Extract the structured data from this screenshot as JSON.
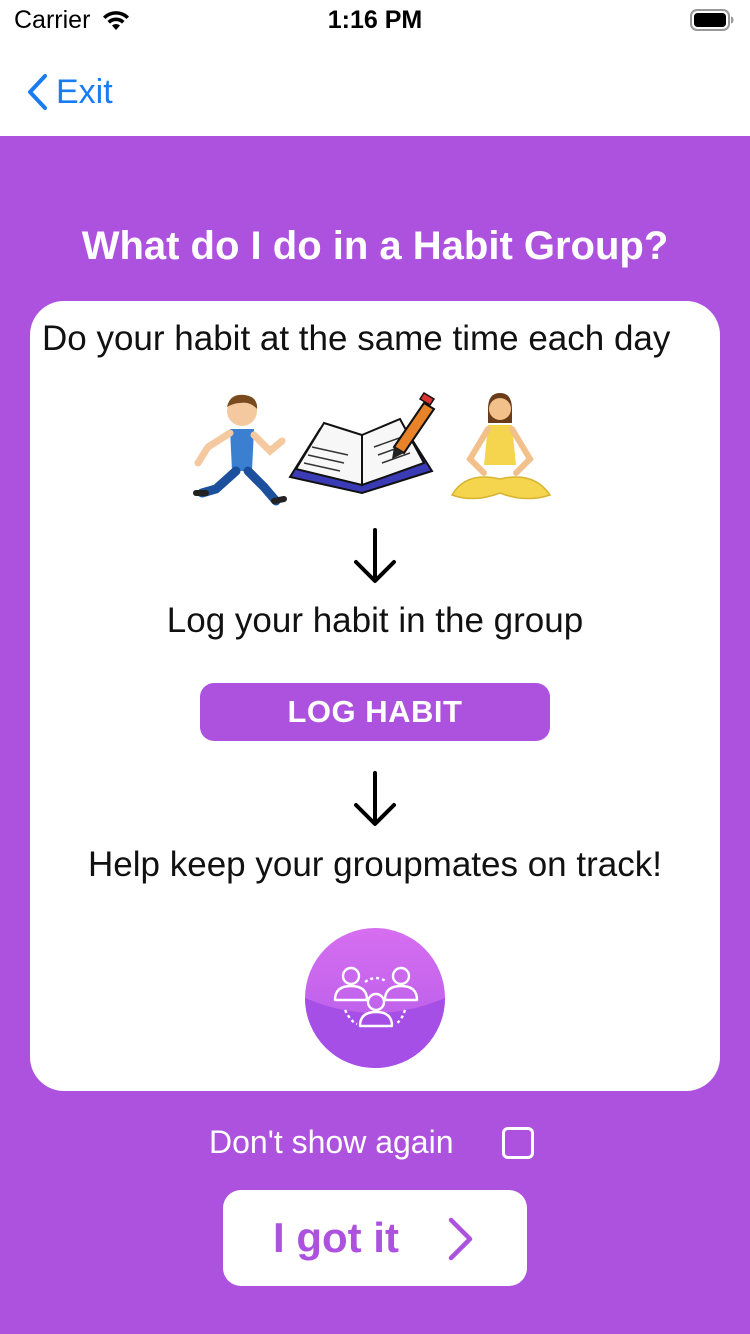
{
  "status_bar": {
    "carrier": "Carrier",
    "time": "1:16 PM"
  },
  "nav": {
    "back_label": "Exit"
  },
  "title": "What do I do in a Habit Group?",
  "card": {
    "step1": "Do your habit at the same time each day",
    "step2": "Log your habit in the group",
    "log_button_label": "LOG HABIT",
    "step3": "Help keep your groupmates on track!"
  },
  "dont_show_again": {
    "label": "Don't show again",
    "checked": false
  },
  "got_it_label": "I got it",
  "colors": {
    "accent": "#ad52de",
    "link": "#1a7cf2",
    "card": "#ffffff"
  },
  "icons": [
    "wifi-icon",
    "battery-icon",
    "chevron-left-icon",
    "runner-illustration",
    "notebook-illustration",
    "yoga-illustration",
    "arrow-down-icon",
    "group-people-icon",
    "chevron-right-icon"
  ]
}
